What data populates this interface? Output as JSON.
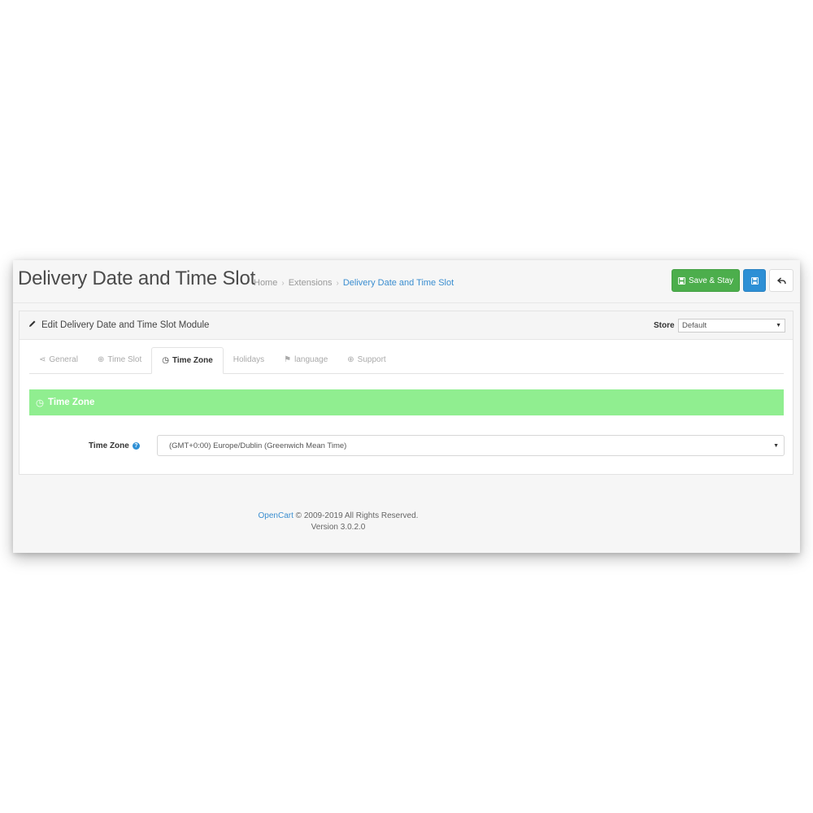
{
  "header": {
    "title": "Delivery Date and Time Slot",
    "breadcrumb": [
      "Home",
      "Extensions",
      "Delivery Date and Time Slot"
    ],
    "save_stay_label": "Save & Stay"
  },
  "card": {
    "title": "Edit Delivery Date and Time Slot Module",
    "store_label": "Store",
    "store_value": "Default"
  },
  "tabs": [
    {
      "label": "General",
      "icon": "share-icon"
    },
    {
      "label": "Time Slot",
      "icon": "clock-icon"
    },
    {
      "label": "Time Zone",
      "icon": "clock-icon",
      "active": true
    },
    {
      "label": "Holidays",
      "icon": ""
    },
    {
      "label": "language",
      "icon": "flag-icon"
    },
    {
      "label": "Support",
      "icon": "support-icon"
    }
  ],
  "section": {
    "title": "Time Zone",
    "color": "#90ee90"
  },
  "form": {
    "timezone_label": "Time Zone",
    "timezone_value": "(GMT+0:00) Europe/Dublin (Greenwich Mean Time)"
  },
  "footer": {
    "brand": "OpenCart",
    "copyright": "© 2009-2019 All Rights Reserved.",
    "version": "Version 3.0.2.0"
  },
  "colors": {
    "success": "#4cae4c",
    "primary": "#2d8fd5",
    "link": "#3b8ed0"
  }
}
